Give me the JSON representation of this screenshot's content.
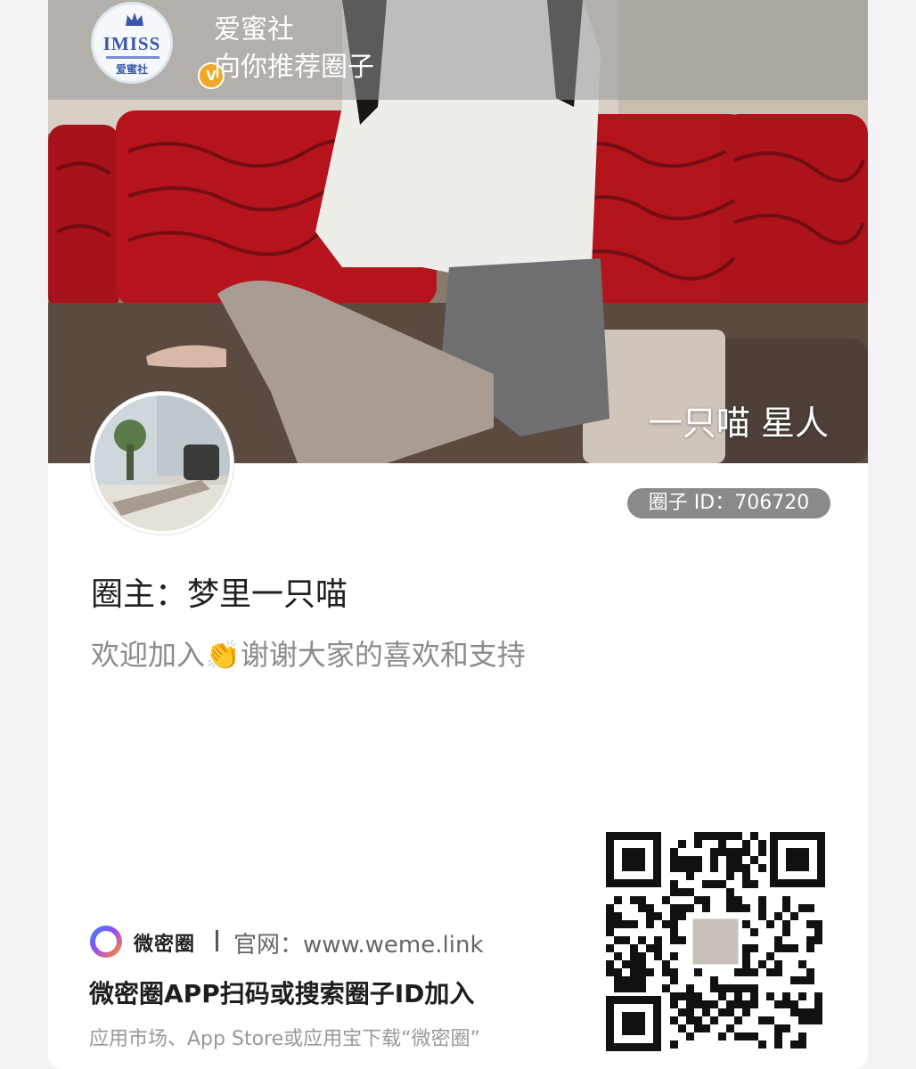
{
  "header": {
    "brand_name": "爱蜜社",
    "brand_subtitle": "向你推荐圈子",
    "logo_wordmark": "IMISS",
    "logo_cn": "爱蜜社",
    "verified_mark": "V"
  },
  "hero": {
    "circle_title": "一只喵 星人"
  },
  "circle": {
    "id_label": "圈子 ID：706720",
    "owner_label": "圈主：梦里一只喵",
    "description": "欢迎加入👏谢谢大家的喜欢和支持"
  },
  "footer": {
    "app_name": "微密圈",
    "website": "官网：www.weme.link",
    "scan_instruction": "微密圈APP扫码或搜索圈子ID加入",
    "store_instruction": "应用市场、App Store或应用宝下载“微密圈”"
  },
  "colors": {
    "badge_bg": "#8a8a8a",
    "sofa_red": "#b5141c",
    "verified_orange": "#f0a828"
  }
}
